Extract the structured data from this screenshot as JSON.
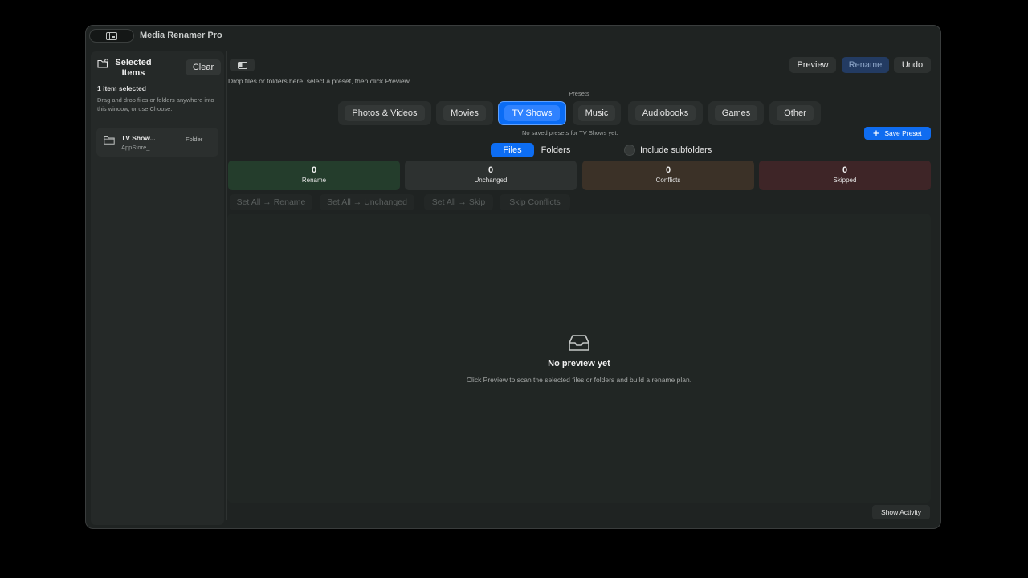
{
  "window": {
    "title": "Media Renamer Pro"
  },
  "sidebar": {
    "title": "Selected Items",
    "clear_label": "Clear",
    "selection_count": "1 item selected",
    "hint": "Drag and drop files or folders anywhere into this window, or use Choose.",
    "items": [
      {
        "name": "TV Show...",
        "subtitle": "AppStore_...",
        "kind": "Folder"
      }
    ]
  },
  "toolbar": {
    "drop_hint": "Drop files or folders here, select a preset, then click Preview.",
    "preview_label": "Preview",
    "rename_label": "Rename",
    "undo_label": "Undo"
  },
  "presets": {
    "label": "Presets",
    "items": [
      "Photos & Videos",
      "Movies",
      "TV Shows",
      "Music",
      "Audiobooks",
      "Games",
      "Other"
    ],
    "selected": "TV Shows",
    "empty_message": "No saved presets for TV Shows yet.",
    "save_label": "Save Preset"
  },
  "mode": {
    "files_label": "Files",
    "folders_label": "Folders",
    "selected": "Files",
    "include_subfolders_label": "Include subfolders",
    "include_subfolders": false
  },
  "stats": [
    {
      "value": "0",
      "label": "Rename",
      "color": "#243d2c"
    },
    {
      "value": "0",
      "label": "Unchanged",
      "color": "#2d3130"
    },
    {
      "value": "0",
      "label": "Conflicts",
      "color": "#3b3127"
    },
    {
      "value": "0",
      "label": "Skipped",
      "color": "#3e2527"
    }
  ],
  "bulk_actions": [
    "Set All → Rename",
    "Set All → Unchanged",
    "Set All → Skip",
    "Skip Conflicts"
  ],
  "preview": {
    "empty_title": "No preview yet",
    "empty_subtitle": "Click Preview to scan the selected files or folders and build a rename plan."
  },
  "footer": {
    "show_activity_label": "Show Activity"
  },
  "colors": {
    "accent": "#0d6df3",
    "window_bg": "#1f2322",
    "sidebar_bg": "#252928"
  }
}
